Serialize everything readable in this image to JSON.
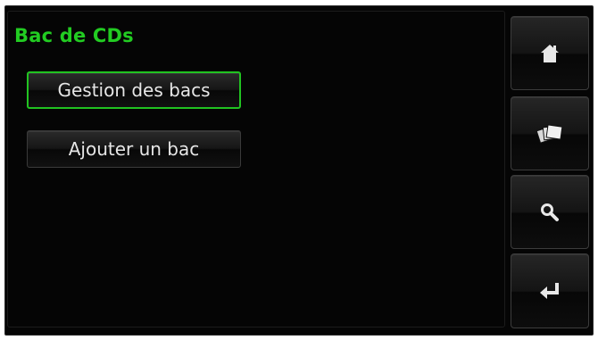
{
  "screen": {
    "title": "Bac de CDs",
    "menu": [
      {
        "label": "Gestion des bacs",
        "selected": true
      },
      {
        "label": "Ajouter un bac",
        "selected": false
      }
    ]
  },
  "sidebar": {
    "buttons": [
      {
        "icon": "home-icon"
      },
      {
        "icon": "cds-icon"
      },
      {
        "icon": "search-icon"
      },
      {
        "icon": "back-enter-icon"
      }
    ]
  },
  "colors": {
    "accent": "#22cc22",
    "background": "#050505",
    "text": "#e6e6e6"
  }
}
